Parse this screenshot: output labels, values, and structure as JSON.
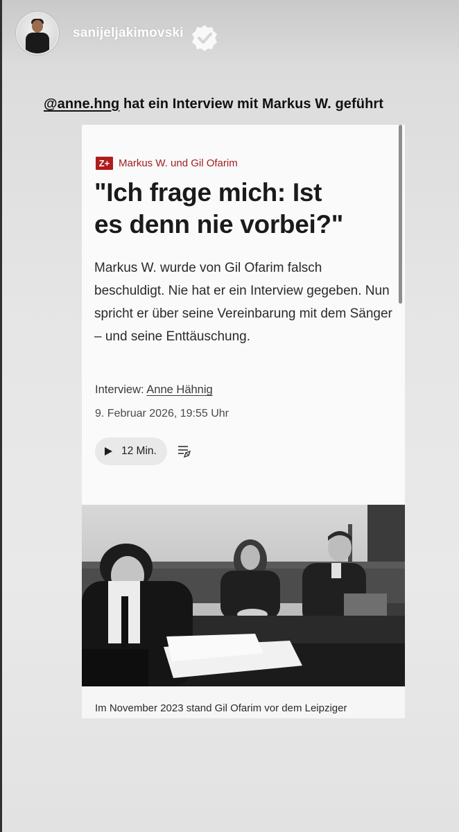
{
  "story": {
    "username": "sanijeljakimovski",
    "avatar_icon": "profile-photo",
    "verified_icon": "verified-badge-icon"
  },
  "caption": {
    "mention": "@anne.hng",
    "text": " hat ein Interview mit Markus W. geführt"
  },
  "article": {
    "badge": "Z+",
    "kicker": "Markus W. und Gil Ofarim",
    "headline_line1": "\"Ich frage mich: Ist",
    "headline_line2": "es denn nie vorbei?\"",
    "teaser": "Markus W. wurde von Gil Ofarim falsch beschuldigt. Nie hat er ein Interview gegeben. Nun spricht er über seine Vereinbarung mit dem Sänger – und seine Enttäuschung.",
    "byline_prefix": "Interview: ",
    "author": "Anne Hähnig",
    "date": "9. Februar 2026, 19:55 Uhr",
    "audio_label": "12 Min.",
    "photo_caption": "Im November 2023 stand Gil Ofarim vor dem Leipziger"
  },
  "colors": {
    "accent_red": "#b01c1c",
    "kicker_red": "#9d1c1c"
  }
}
